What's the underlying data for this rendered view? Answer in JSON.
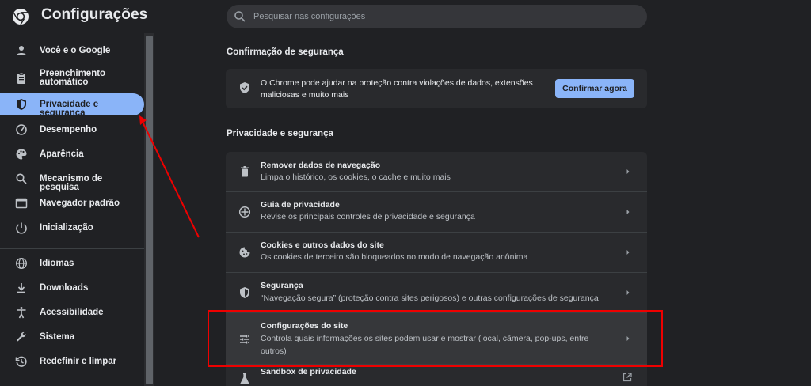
{
  "header": {
    "app_title": "Configurações",
    "search_placeholder": "Pesquisar nas configurações"
  },
  "sidebar": {
    "items": [
      {
        "label": "Você e o Google",
        "icon": "person-icon"
      },
      {
        "label": "Preenchimento automático",
        "icon": "clipboard-icon"
      },
      {
        "label": "Privacidade e segurança",
        "icon": "shield-icon",
        "active": true
      },
      {
        "label": "Desempenho",
        "icon": "speedometer-icon"
      },
      {
        "label": "Aparência",
        "icon": "palette-icon"
      },
      {
        "label": "Mecanismo de pesquisa",
        "icon": "search-icon"
      },
      {
        "label": "Navegador padrão",
        "icon": "browser-icon"
      },
      {
        "label": "Inicialização",
        "icon": "power-icon"
      },
      {
        "label": "Idiomas",
        "icon": "globe-icon"
      },
      {
        "label": "Downloads",
        "icon": "download-icon"
      },
      {
        "label": "Acessibilidade",
        "icon": "accessibility-icon"
      },
      {
        "label": "Sistema",
        "icon": "wrench-icon"
      },
      {
        "label": "Redefinir e limpar",
        "icon": "reset-icon"
      }
    ]
  },
  "safety_check": {
    "title": "Confirmação de segurança",
    "text": "O Chrome pode ajudar na proteção contra violações de dados, extensões maliciosas e muito mais",
    "button_label": "Confirmar agora"
  },
  "privacy": {
    "title": "Privacidade e segurança",
    "rows": [
      {
        "title": "Remover dados de navegação",
        "desc": "Limpa o histórico, os cookies, o cache e muito mais",
        "icon": "trash-icon"
      },
      {
        "title": "Guia de privacidade",
        "desc": "Revise os principais controles de privacidade e segurança",
        "icon": "compass-icon"
      },
      {
        "title": "Cookies e outros dados do site",
        "desc": "Os cookies de terceiro são bloqueados no modo de navegação anônima",
        "icon": "cookie-icon"
      },
      {
        "title": "Segurança",
        "desc": "“Navegação segura” (proteção contra sites perigosos) e outras configurações de segurança",
        "icon": "shield-icon"
      },
      {
        "title": "Configurações do site",
        "desc": "Controla quais informações os sites podem usar e mostrar (local, câmera, pop-ups, entre outros)",
        "icon": "sliders-icon"
      },
      {
        "title": "Sandbox de privacidade",
        "desc": "",
        "icon": "flask-icon"
      }
    ]
  },
  "colors": {
    "accent": "#8ab4f8",
    "background": "#202124",
    "card": "#292a2d",
    "annotation": "#e00000"
  }
}
